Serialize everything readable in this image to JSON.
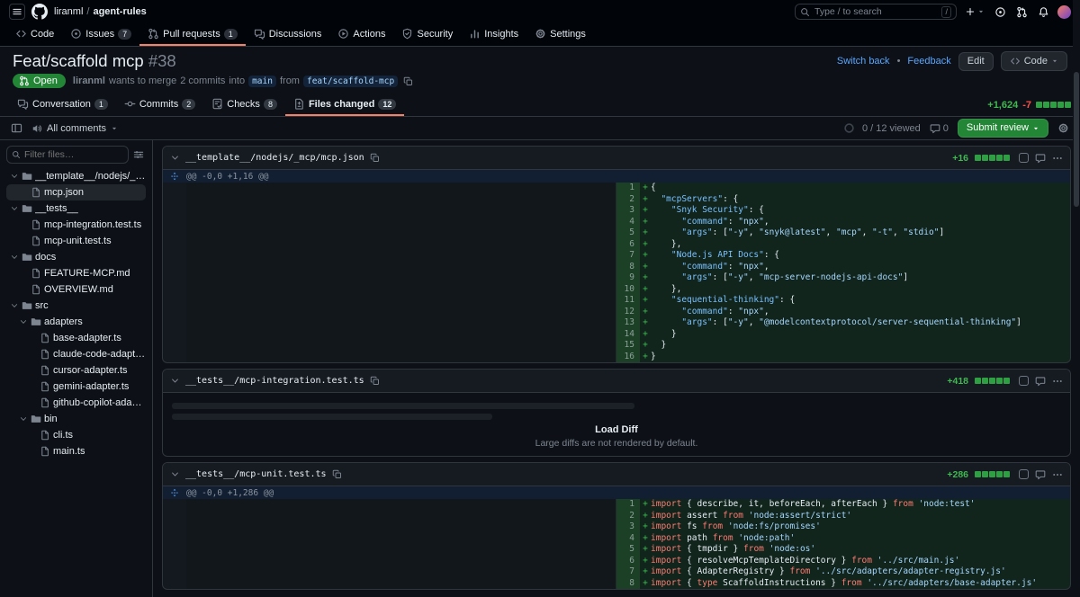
{
  "header": {
    "owner": "liranml",
    "separator": "/",
    "repo": "agent-rules",
    "search_placeholder": "Type / to search",
    "slash_hint": "/"
  },
  "repo_tabs": [
    {
      "label": "Code",
      "icon": "code"
    },
    {
      "label": "Issues",
      "icon": "issue-opened",
      "count": "7"
    },
    {
      "label": "Pull requests",
      "icon": "git-pull-request",
      "count": "1",
      "selected": true
    },
    {
      "label": "Discussions",
      "icon": "comment-discussion"
    },
    {
      "label": "Actions",
      "icon": "play"
    },
    {
      "label": "Security",
      "icon": "shield"
    },
    {
      "label": "Insights",
      "icon": "graph"
    },
    {
      "label": "Settings",
      "icon": "gear"
    }
  ],
  "pr": {
    "title": "Feat/scaffold mcp",
    "number": "#38",
    "state": "Open",
    "author": "liranml",
    "wants_to_merge": "wants to merge",
    "commits_link": "2 commits",
    "into_word": "into",
    "base_branch": "main",
    "from_word": "from",
    "head_branch": "feat/scaffold-mcp",
    "switch_back": "Switch back",
    "bullet": "•",
    "feedback": "Feedback",
    "edit_button": "Edit",
    "code_button": "Code"
  },
  "pr_tabs": [
    {
      "label": "Conversation",
      "icon": "comment-discussion",
      "count": "1"
    },
    {
      "label": "Commits",
      "icon": "git-commit",
      "count": "2"
    },
    {
      "label": "Checks",
      "icon": "checklist",
      "count": "8"
    },
    {
      "label": "Files changed",
      "icon": "file-diff",
      "count": "12",
      "selected": true
    }
  ],
  "diffstat": {
    "additions": "+1,624",
    "deletions": "-7",
    "blocks": [
      "add",
      "add",
      "add",
      "add",
      "add"
    ]
  },
  "toolbar": {
    "comments_filter": "All comments",
    "viewed_progress": "0 / 12 viewed",
    "comment_count": "0",
    "submit_review": "Submit review"
  },
  "file_tree": {
    "filter_placeholder": "Filter files…",
    "items": [
      {
        "depth": 0,
        "type": "dir",
        "name": "__template__/nodejs/_mcp"
      },
      {
        "depth": 1,
        "type": "file",
        "name": "mcp.json",
        "active": true
      },
      {
        "depth": 0,
        "type": "dir",
        "name": "__tests__"
      },
      {
        "depth": 1,
        "type": "file",
        "name": "mcp-integration.test.ts"
      },
      {
        "depth": 1,
        "type": "file",
        "name": "mcp-unit.test.ts"
      },
      {
        "depth": 0,
        "type": "dir",
        "name": "docs"
      },
      {
        "depth": 1,
        "type": "file",
        "name": "FEATURE-MCP.md"
      },
      {
        "depth": 1,
        "type": "file",
        "name": "OVERVIEW.md"
      },
      {
        "depth": 0,
        "type": "dir",
        "name": "src"
      },
      {
        "depth": 1,
        "type": "dir",
        "name": "adapters"
      },
      {
        "depth": 2,
        "type": "file",
        "name": "base-adapter.ts"
      },
      {
        "depth": 2,
        "type": "file",
        "name": "claude-code-adapter.ts"
      },
      {
        "depth": 2,
        "type": "file",
        "name": "cursor-adapter.ts"
      },
      {
        "depth": 2,
        "type": "file",
        "name": "gemini-adapter.ts"
      },
      {
        "depth": 2,
        "type": "file",
        "name": "github-copilot-adapter.ts"
      },
      {
        "depth": 1,
        "type": "dir",
        "name": "bin"
      },
      {
        "depth": 2,
        "type": "file",
        "name": "cli.ts"
      },
      {
        "depth": 2,
        "type": "file",
        "name": "main.ts"
      }
    ]
  },
  "load_diff": {
    "button": "Load Diff",
    "message": "Large diffs are not rendered by default."
  },
  "files": [
    {
      "path": "__template__/nodejs/_mcp/mcp.json",
      "additions": "+16",
      "blocks": [
        "add",
        "add",
        "add",
        "add",
        "add"
      ],
      "type": "diff",
      "hunk": "@@ -0,0 +1,16 @@",
      "lines": [
        [
          [
            "p",
            "{"
          ]
        ],
        [
          [
            "p",
            "  "
          ],
          [
            "k",
            "\"mcpServers\""
          ],
          [
            "p",
            ": {"
          ]
        ],
        [
          [
            "p",
            "    "
          ],
          [
            "k",
            "\"Snyk Security\""
          ],
          [
            "p",
            ": {"
          ]
        ],
        [
          [
            "p",
            "      "
          ],
          [
            "k",
            "\"command\""
          ],
          [
            "p",
            ": "
          ],
          [
            "s",
            "\"npx\""
          ],
          [
            "p",
            ","
          ]
        ],
        [
          [
            "p",
            "      "
          ],
          [
            "k",
            "\"args\""
          ],
          [
            "p",
            ": ["
          ],
          [
            "s",
            "\"-y\""
          ],
          [
            "p",
            ", "
          ],
          [
            "s",
            "\"snyk@latest\""
          ],
          [
            "p",
            ", "
          ],
          [
            "s",
            "\"mcp\""
          ],
          [
            "p",
            ", "
          ],
          [
            "s",
            "\"-t\""
          ],
          [
            "p",
            ", "
          ],
          [
            "s",
            "\"stdio\""
          ],
          [
            "p",
            "]"
          ]
        ],
        [
          [
            "p",
            "    },"
          ]
        ],
        [
          [
            "p",
            "    "
          ],
          [
            "k",
            "\"Node.js API Docs\""
          ],
          [
            "p",
            ": {"
          ]
        ],
        [
          [
            "p",
            "      "
          ],
          [
            "k",
            "\"command\""
          ],
          [
            "p",
            ": "
          ],
          [
            "s",
            "\"npx\""
          ],
          [
            "p",
            ","
          ]
        ],
        [
          [
            "p",
            "      "
          ],
          [
            "k",
            "\"args\""
          ],
          [
            "p",
            ": ["
          ],
          [
            "s",
            "\"-y\""
          ],
          [
            "p",
            ", "
          ],
          [
            "s",
            "\"mcp-server-nodejs-api-docs\""
          ],
          [
            "p",
            "]"
          ]
        ],
        [
          [
            "p",
            "    },"
          ]
        ],
        [
          [
            "p",
            "    "
          ],
          [
            "k",
            "\"sequential-thinking\""
          ],
          [
            "p",
            ": {"
          ]
        ],
        [
          [
            "p",
            "      "
          ],
          [
            "k",
            "\"command\""
          ],
          [
            "p",
            ": "
          ],
          [
            "s",
            "\"npx\""
          ],
          [
            "p",
            ","
          ]
        ],
        [
          [
            "p",
            "      "
          ],
          [
            "k",
            "\"args\""
          ],
          [
            "p",
            ": ["
          ],
          [
            "s",
            "\"-y\""
          ],
          [
            "p",
            ", "
          ],
          [
            "s",
            "\"@modelcontextprotocol/server-sequential-thinking\""
          ],
          [
            "p",
            "]"
          ]
        ],
        [
          [
            "p",
            "    }"
          ]
        ],
        [
          [
            "p",
            "  }"
          ]
        ],
        [
          [
            "p",
            "}"
          ]
        ]
      ]
    },
    {
      "path": "__tests__/mcp-integration.test.ts",
      "additions": "+418",
      "blocks": [
        "add",
        "add",
        "add",
        "add",
        "add"
      ],
      "type": "load"
    },
    {
      "path": "__tests__/mcp-unit.test.ts",
      "additions": "+286",
      "blocks": [
        "add",
        "add",
        "add",
        "add",
        "add"
      ],
      "type": "diff",
      "hunk": "@@ -0,0 +1,286 @@",
      "lines": [
        [
          [
            "w",
            "import"
          ],
          [
            "p",
            " { "
          ],
          [
            "n",
            "describe"
          ],
          [
            "p",
            ", "
          ],
          [
            "n",
            "it"
          ],
          [
            "p",
            ", "
          ],
          [
            "n",
            "beforeEach"
          ],
          [
            "p",
            ", "
          ],
          [
            "n",
            "afterEach"
          ],
          [
            "p",
            " } "
          ],
          [
            "w",
            "from"
          ],
          [
            "p",
            " "
          ],
          [
            "s",
            "'node:test'"
          ]
        ],
        [
          [
            "w",
            "import"
          ],
          [
            "p",
            " "
          ],
          [
            "n",
            "assert"
          ],
          [
            "p",
            " "
          ],
          [
            "w",
            "from"
          ],
          [
            "p",
            " "
          ],
          [
            "s",
            "'node:assert/strict'"
          ]
        ],
        [
          [
            "w",
            "import"
          ],
          [
            "p",
            " "
          ],
          [
            "n",
            "fs"
          ],
          [
            "p",
            " "
          ],
          [
            "w",
            "from"
          ],
          [
            "p",
            " "
          ],
          [
            "s",
            "'node:fs/promises'"
          ]
        ],
        [
          [
            "w",
            "import"
          ],
          [
            "p",
            " "
          ],
          [
            "n",
            "path"
          ],
          [
            "p",
            " "
          ],
          [
            "w",
            "from"
          ],
          [
            "p",
            " "
          ],
          [
            "s",
            "'node:path'"
          ]
        ],
        [
          [
            "w",
            "import"
          ],
          [
            "p",
            " { "
          ],
          [
            "n",
            "tmpdir"
          ],
          [
            "p",
            " } "
          ],
          [
            "w",
            "from"
          ],
          [
            "p",
            " "
          ],
          [
            "s",
            "'node:os'"
          ]
        ],
        [
          [
            "w",
            "import"
          ],
          [
            "p",
            " { "
          ],
          [
            "n",
            "resolveMcpTemplateDirectory"
          ],
          [
            "p",
            " } "
          ],
          [
            "w",
            "from"
          ],
          [
            "p",
            " "
          ],
          [
            "s",
            "'../src/main.js'"
          ]
        ],
        [
          [
            "w",
            "import"
          ],
          [
            "p",
            " { "
          ],
          [
            "n",
            "AdapterRegistry"
          ],
          [
            "p",
            " } "
          ],
          [
            "w",
            "from"
          ],
          [
            "p",
            " "
          ],
          [
            "s",
            "'../src/adapters/adapter-registry.js'"
          ]
        ],
        [
          [
            "w",
            "import"
          ],
          [
            "p",
            " { "
          ],
          [
            "w",
            "type"
          ],
          [
            "p",
            " "
          ],
          [
            "n",
            "ScaffoldInstructions"
          ],
          [
            "p",
            " } "
          ],
          [
            "w",
            "from"
          ],
          [
            "p",
            " "
          ],
          [
            "s",
            "'../src/adapters/base-adapter.js'"
          ]
        ]
      ]
    }
  ]
}
